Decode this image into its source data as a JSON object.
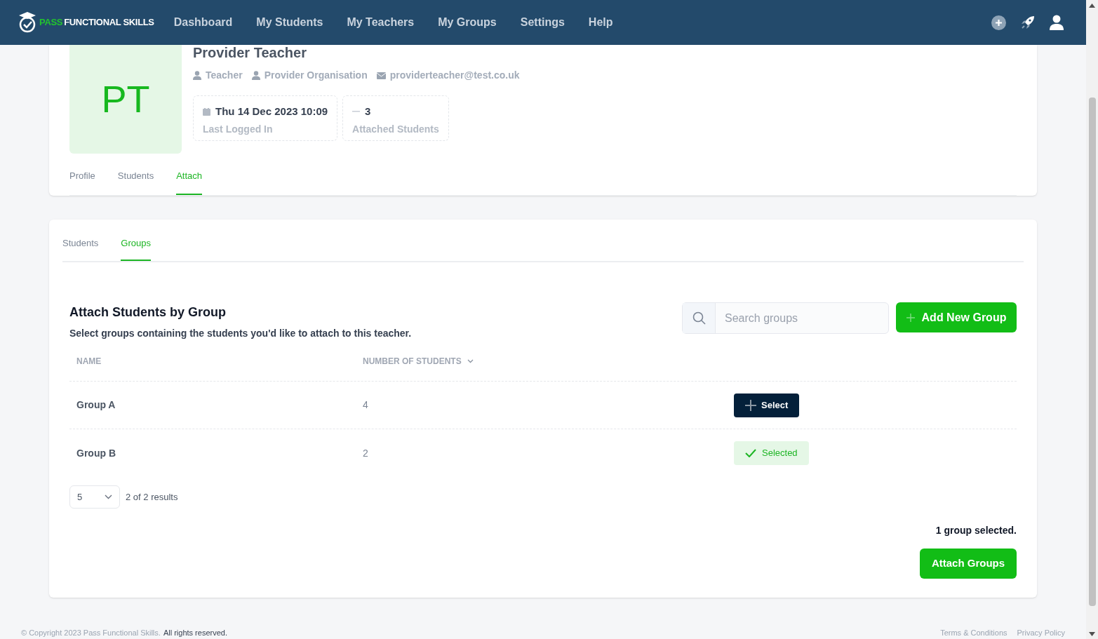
{
  "brand": {
    "accent": "PASS",
    "name": "FUNCTIONAL SKILLS"
  },
  "nav": [
    {
      "label": "Dashboard"
    },
    {
      "label": "My Students"
    },
    {
      "label": "My Teachers"
    },
    {
      "label": "My Groups"
    },
    {
      "label": "Settings"
    },
    {
      "label": "Help"
    }
  ],
  "profile": {
    "initials": "PT",
    "name": "Provider Teacher",
    "role": "Teacher",
    "organisation": "Provider Organisation",
    "email": "providerteacher@test.co.uk",
    "stats": [
      {
        "kind": "date",
        "value": "Thu 14 Dec 2023 10:09",
        "label": "Last Logged In"
      },
      {
        "kind": "count",
        "value": "3",
        "label": "Attached Students"
      }
    ],
    "tabs": [
      {
        "label": "Profile",
        "selected": false
      },
      {
        "label": "Students",
        "selected": false
      },
      {
        "label": "Attach",
        "selected": true
      }
    ]
  },
  "attach": {
    "tabs": [
      {
        "label": "Students",
        "selected": false
      },
      {
        "label": "Groups",
        "selected": true
      }
    ],
    "title": "Attach Students by Group",
    "subtitle": "Select groups containing the students you'd like to attach to this teacher.",
    "search": {
      "placeholder": "Search groups"
    },
    "add_button": "Add New Group",
    "table": {
      "columns": [
        "NAME",
        "NUMBER OF STUDENTS"
      ],
      "rows": [
        {
          "name": "Group A",
          "count": "4",
          "action": "Select",
          "selected": false
        },
        {
          "name": "Group B",
          "count": "2",
          "action": "Selected",
          "selected": true
        }
      ]
    },
    "page_size": "5",
    "results": "2 of 2 results",
    "selection_summary": "1 group selected.",
    "attach_button": "Attach Groups"
  },
  "footer": {
    "copyright": "© Copyright 2023 Pass Functional Skills.",
    "rights": "All rights reserved.",
    "links": [
      "Terms & Conditions",
      "Privacy Policy"
    ]
  }
}
